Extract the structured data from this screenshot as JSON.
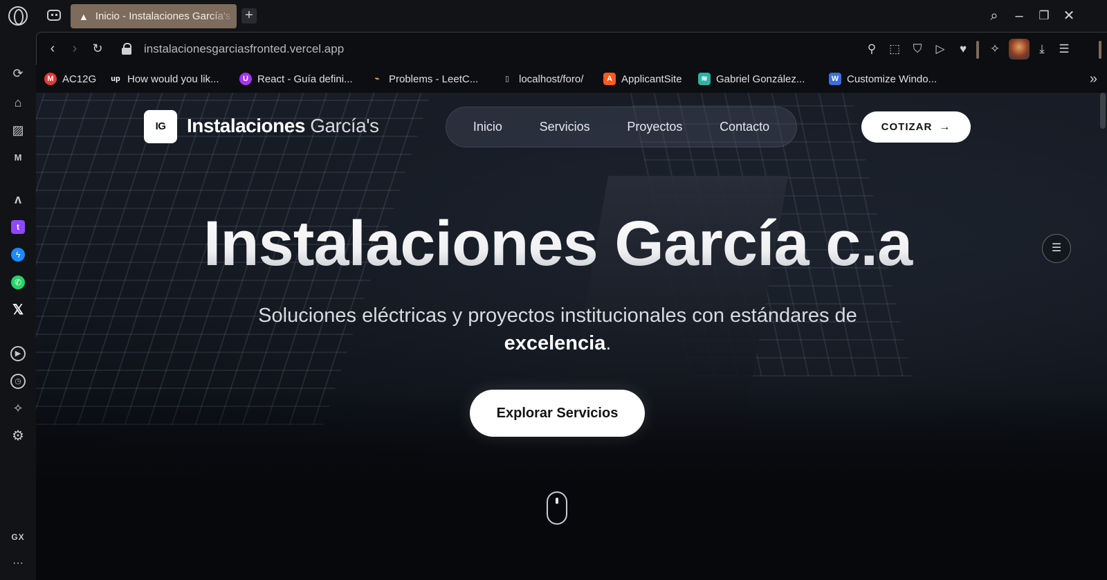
{
  "browser": {
    "tab": {
      "title": "Inicio - Instalaciones García's",
      "new_tab_label": "+"
    },
    "window": {
      "search": "⌕",
      "minimize": "–",
      "restore": "❐",
      "close": "✕"
    },
    "address": {
      "url": "instalacionesgarciasfronted.vercel.app"
    },
    "bookmarks": [
      {
        "label": "AC12G",
        "icon": "gmail-icon",
        "color": "#e53935",
        "glyph": "M"
      },
      {
        "label": "How would you lik...",
        "icon": "upwork-icon",
        "color": "#0d0e11",
        "glyph": "up"
      },
      {
        "label": "React - Guía defini...",
        "icon": "udemy-icon",
        "color": "#a435f0",
        "glyph": "U"
      },
      {
        "label": "Problems - LeetC...",
        "icon": "leetcode-icon",
        "color": "#0d0e11",
        "glyph": "⌁"
      },
      {
        "label": "localhost/foro/",
        "icon": "page-icon",
        "color": "#0d0e11",
        "glyph": "▯"
      },
      {
        "label": "ApplicantSite",
        "icon": "applicantsite-icon",
        "color": "#ff5a1f",
        "glyph": "A"
      },
      {
        "label": "Gabriel González...",
        "icon": "site-icon",
        "color": "#2bb3a3",
        "glyph": "≋"
      },
      {
        "label": "Customize Windo...",
        "icon": "customize-icon",
        "color": "#3b6fd8",
        "glyph": "W"
      }
    ]
  },
  "site": {
    "logo_initials": "IG",
    "logo_bold": "Instalaciones",
    "logo_light": "García's",
    "nav": [
      "Inicio",
      "Servicios",
      "Proyectos",
      "Contacto"
    ],
    "cta_label": "COTIZAR",
    "hero_title": "Instalaciones García c.a",
    "hero_sub_text": "Soluciones eléctricas y proyectos institucionales con estándares de",
    "hero_sub_bold": "excelencia",
    "hero_sub_end": ".",
    "explore_label": "Explorar Servicios"
  },
  "sidebar": {
    "gx_label": "GX",
    "more_label": "···"
  }
}
